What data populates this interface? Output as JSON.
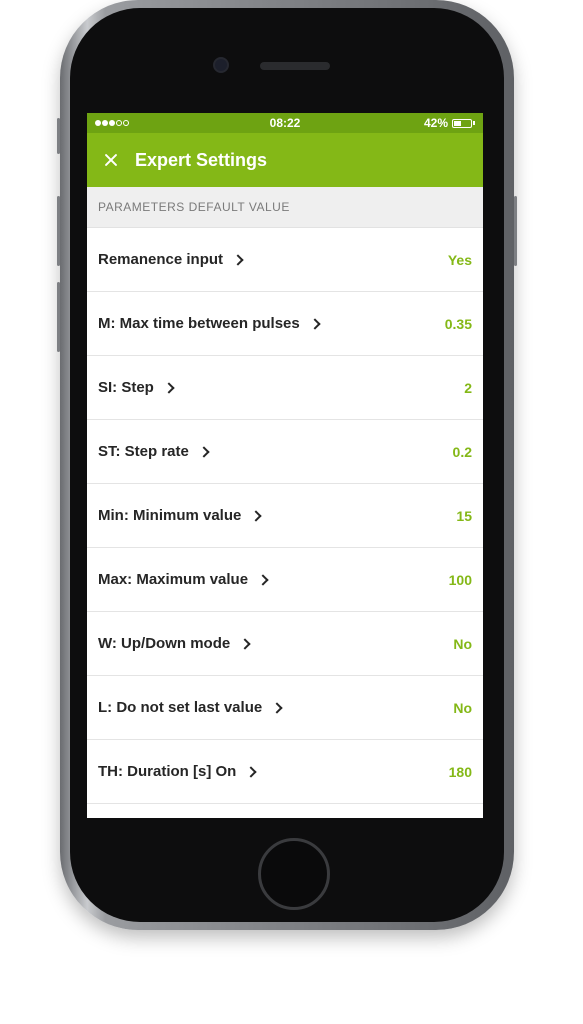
{
  "status_bar": {
    "time": "08:22",
    "battery_percent": "42%",
    "battery_level": 0.42,
    "signal_filled": 3,
    "signal_total": 5
  },
  "app_bar": {
    "title": "Expert Settings",
    "close_icon": "close-icon"
  },
  "section": {
    "header": "PARAMETERS DEFAULT VALUE"
  },
  "settings": [
    {
      "label": "Remanence input",
      "value": "Yes"
    },
    {
      "label": "M: Max time between pulses",
      "value": "0.35"
    },
    {
      "label": "SI: Step",
      "value": "2"
    },
    {
      "label": "ST: Step rate",
      "value": "0.2"
    },
    {
      "label": "Min: Minimum value",
      "value": "15"
    },
    {
      "label": "Max: Maximum value",
      "value": "100"
    },
    {
      "label": "W: Up/Down mode",
      "value": "No"
    },
    {
      "label": "L: Do not set last value",
      "value": "No"
    },
    {
      "label": "TH: Duration [s] On",
      "value": "180"
    }
  ],
  "colors": {
    "accent": "#84b817",
    "status_bar": "#6ea312",
    "value_text": "#84b817"
  }
}
